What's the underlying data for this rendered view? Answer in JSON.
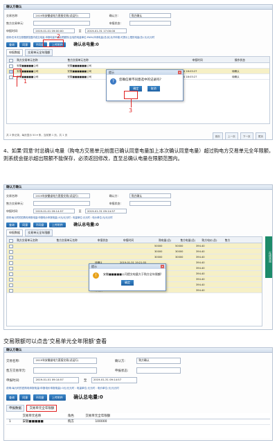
{
  "shot1": {
    "window_title": "确认方确认",
    "fields": {
      "trade_name_label": "交易名称:",
      "trade_name_value": "2019年安徽省电力直接交易(试运行)",
      "confirmer_label": "确认方:",
      "confirmer_value": "购方确认",
      "seller_unit_label": "售方交易单元:",
      "status_label": "申报状态:",
      "time_label": "申报时间:",
      "time_start": "2019-01-01 09:00:00",
      "time_to": "至",
      "time_end": "2019-01-31 17:00:00"
    },
    "notice": "说明:在本次交易限额范围内成交电量,申报电量不超出限额的(比较的电量单位:MWh)申请电量(总/买)允许申报,可提示上限的电量(总):元/元元时",
    "buttons": [
      "查询",
      "同意",
      "不同意",
      "上传附件"
    ],
    "total_label": "确认总电量:0",
    "tabs": [
      "申报数据",
      "交易单元全年限额"
    ],
    "columns": [
      "购方交易单元名称",
      "售方交易单元名称",
      "申报时间",
      "操作状态"
    ],
    "rows": [
      {
        "buyer": "安徽■■■■■公司",
        "seller": "安徽■■■■■■公司",
        "time": "2019-01-14 18:03:27",
        "status": "待确认"
      },
      {
        "buyer": "安徽■■■■■公司",
        "seller": "安徽■■■■■■公司",
        "time": "2019-01-14 18:03:27",
        "status": "待确认"
      }
    ],
    "dialog": {
      "title": "提示",
      "message": "您确信要不同意选中的记录吗?",
      "ok": "确定",
      "cancel": "取消"
    },
    "footer": "共 2 条记录，每页显示 50 ▾ 条，当前第 1 页，共 1 页",
    "pager": [
      "首页",
      "上一页",
      "下一页",
      "尾页"
    ],
    "annotations": [
      "1",
      "2",
      "3"
    ]
  },
  "paragraph": "4、如果‘同意’时总确认电量（购电方交易单元前面已确认同意电量加上本次确认同意电量）超过购电方交易单元全年限额，则系统会提示超出限额不能保存，必须返回修改，直至总确认电量在限额范围内。",
  "shot2": {
    "window_title": "确认方确认",
    "trade_name_value": "2019年安徽省电力直接交易(试运行)",
    "confirmer_value": "购方确认",
    "time_start": "2019-01-01 09:14:57",
    "time_end": "2019-01-31 09:14:57",
    "notice": "说明:每元时的四购电申报电量:申报电价申报电量(:0元/元元时 : 电量单位:元元时 : 电价单位:元/元元时",
    "buttons": [
      "查询",
      "同意",
      "不同意",
      "上传附件"
    ],
    "total_label": "确认总电量:0",
    "tabs": [
      "申报数据",
      "交易单元全年限额"
    ],
    "columns": [
      "购方交易单元名称",
      "售方交易单元名称",
      "申报状态",
      "申报时间",
      "购电量(总)",
      "售方电量(总)",
      "购方电价(总)",
      "售方"
    ],
    "rows": [
      {
        "status": "",
        "time": "",
        "e1": "50000",
        "e2": "50000",
        "p": "394.40"
      },
      {
        "status": "",
        "time": "",
        "e1": "30000",
        "e2": "30000",
        "p": "394.40"
      },
      {
        "status": "",
        "time": "",
        "e1": "30000",
        "e2": "30000",
        "p": "394.40"
      },
      {
        "status": "待确认",
        "time": "2019-01-31 19:21:55",
        "e1": "",
        "e2": "",
        "p": "394.40"
      },
      {
        "status": "待确认",
        "time": "2019-01-01 09:14:11",
        "e1": "",
        "e2": "",
        "p": "394.40"
      },
      {
        "status": "待确认",
        "time": "2019-01-01 09:14:28",
        "e1": "",
        "e2": "",
        "p": "394.40"
      },
      {
        "status": "待确认",
        "time": "2019-01-01 09:14:21",
        "e1": "",
        "e2": "",
        "p": "394.40"
      },
      {
        "status": "待确认",
        "time": "2019-01-01 09:14:11",
        "e1": "",
        "e2": "",
        "p": "394.40"
      },
      {
        "status": "待确认",
        "time": "2019-01-01 09:14:35",
        "e1": "",
        "e2": "",
        "p": "394.40"
      }
    ],
    "dialog": {
      "title": "提示",
      "message": "安徽■■■■■公司提交电量大于购方全年限额!",
      "ok": "确定"
    },
    "side_label": "在线咨询"
  },
  "heading2": "交易限额可以点击‘交易单元全年限额’查看",
  "shot3": {
    "window_title": "确认方确认",
    "trade_name_label": "交易名称:",
    "trade_name_value": "2019年安徽省电力直接交易(试运行)",
    "confirmer_label": "确认方:",
    "confirmer_value": "购方确认",
    "seller_unit_label": "售方交易单元:",
    "status_label": "申报状态:",
    "time_label": "申报时间:",
    "time_start": "2019-01-01 09:14:57",
    "time_to": "至",
    "time_end": "2019-01-31 09:14:57",
    "notice": "说明:每元时的四购电申报电量:申报电价申报电量(:0元/元元时 : 电量单位:元元时 : 电价单位:元/元元时",
    "buttons": [
      "查询",
      "同意",
      "不同意",
      "上传附件"
    ],
    "total_label": "确认总电量:0",
    "tabs": [
      "申报数据",
      "交易单元全年限额"
    ],
    "columns": [
      "交易单元名称",
      "角色",
      "交易单元全年限额"
    ],
    "row": {
      "index": "1",
      "name": "安徽■■■■■",
      "role": "购方",
      "limit": "100000"
    }
  }
}
